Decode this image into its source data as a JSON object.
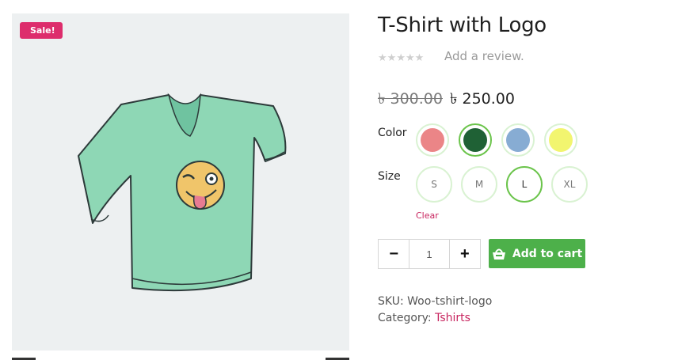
{
  "gallery": {
    "sale_badge": "Sale!",
    "image_icon": "tshirt-with-winking-emoji"
  },
  "product": {
    "title": "T-Shirt with Logo",
    "rating_stars": 5,
    "rating_value": 0,
    "review_link": "Add a review.",
    "price_old": "৳ 300.00",
    "price_new": "৳ 250.00"
  },
  "attributes": {
    "color": {
      "label": "Color",
      "options": [
        {
          "name": "pink",
          "hex": "#eb8587",
          "selected": false
        },
        {
          "name": "green",
          "hex": "#1f6135",
          "selected": true
        },
        {
          "name": "blue",
          "hex": "#87acd3",
          "selected": false
        },
        {
          "name": "yellow",
          "hex": "#f2f56f",
          "selected": false
        }
      ]
    },
    "size": {
      "label": "Size",
      "options": [
        {
          "label": "S",
          "selected": false
        },
        {
          "label": "M",
          "selected": false
        },
        {
          "label": "L",
          "selected": true
        },
        {
          "label": "XL",
          "selected": false
        }
      ],
      "clear": "Clear"
    }
  },
  "cart": {
    "minus_label": "−",
    "quantity": "1",
    "plus_label": "+",
    "add_to_cart_label": "Add to cart",
    "add_to_cart_icon": "basket-icon"
  },
  "meta": {
    "sku_label": "SKU:",
    "sku_value": "Woo-tshirt-logo",
    "category_label": "Category:",
    "category_value": "Tshirts"
  },
  "colors": {
    "accent_green": "#4db04a",
    "sale_pink": "#dd2d6c",
    "link_pink": "#c8255f",
    "swatch_ring": "#d9f2d2",
    "swatch_ring_selected": "#6bc44b"
  }
}
